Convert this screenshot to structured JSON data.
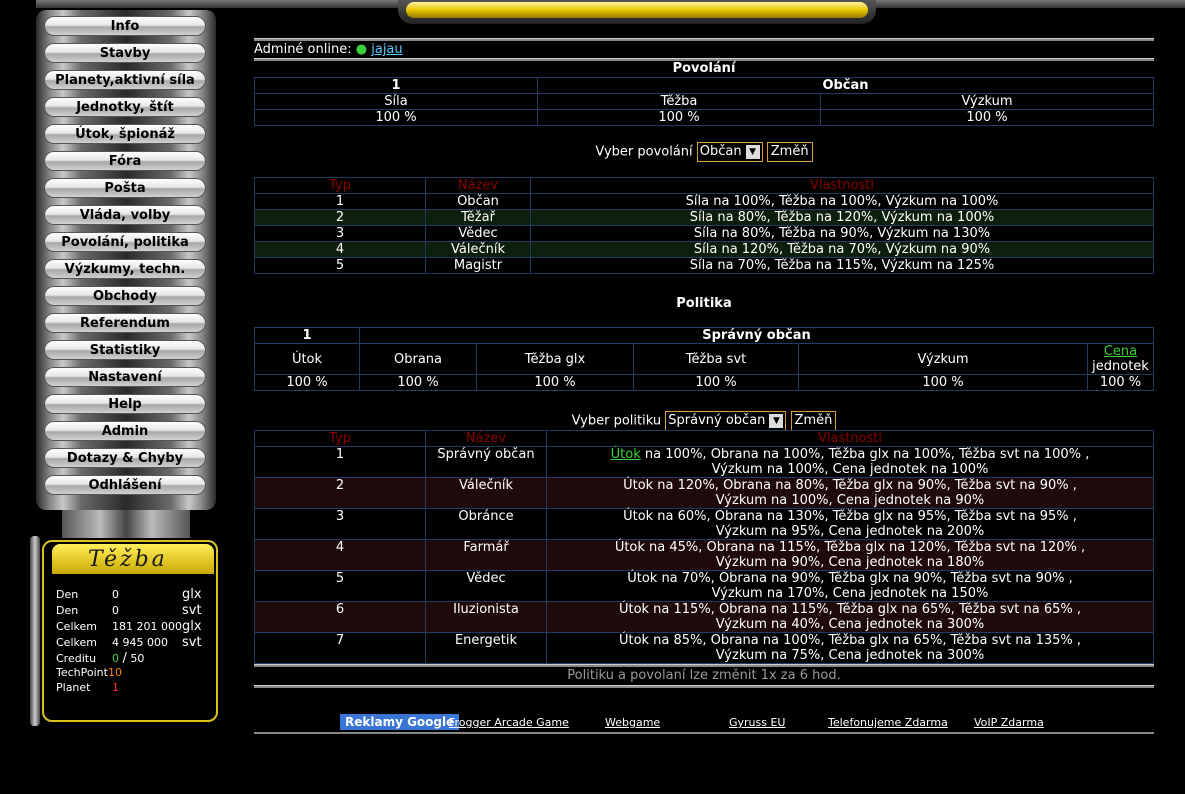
{
  "sidebar": {
    "items": [
      {
        "label": "Info"
      },
      {
        "label": "Stavby"
      },
      {
        "label": "Planety,aktivní síla"
      },
      {
        "label": "Jednotky, štít"
      },
      {
        "label": "Útok, špionáž"
      },
      {
        "label": "Fóra"
      },
      {
        "label": "Pošta"
      },
      {
        "label": "Vláda, volby"
      },
      {
        "label": "Povolání, politika"
      },
      {
        "label": "Výzkumy, techn."
      },
      {
        "label": "Obchody"
      },
      {
        "label": "Referendum"
      },
      {
        "label": "Statistiky"
      },
      {
        "label": "Nastavení"
      },
      {
        "label": "Help"
      },
      {
        "label": "Admin"
      },
      {
        "label": "Dotazy & Chyby"
      },
      {
        "label": "Odhlášení"
      }
    ]
  },
  "resources": {
    "title": "Těžba",
    "rows": [
      {
        "label": "Den",
        "value": "0",
        "unit": "glx"
      },
      {
        "label": "Den",
        "value": "0",
        "unit": "svt"
      },
      {
        "label": "Celkem",
        "value": "181 201 000",
        "unit": "glx"
      },
      {
        "label": "Celkem",
        "value": "4 945 000",
        "unit": "svt"
      }
    ],
    "credit_label": "Creditu",
    "credit_value": "0",
    "credit_sep": "/",
    "credit_max": "50",
    "techpoint_label": "TechPoint",
    "techpoint_value": "10",
    "planet_label": "Planet",
    "planet_value": "1"
  },
  "online": {
    "label": "Adminé online:",
    "user": "jajau"
  },
  "povolani": {
    "title": "Povolání",
    "current_id": "1",
    "current_name": "Občan",
    "stats_headers": [
      "Síla",
      "Těžba",
      "Výzkum"
    ],
    "stats_values": [
      "100 %",
      "100 %",
      "100 %"
    ],
    "select_label": "Vyber povolání",
    "select_value": "Občan",
    "button": "Změň",
    "list_headers": [
      "Typ",
      "Název",
      "Vlastnosti"
    ],
    "list": [
      {
        "id": "1",
        "name": "Občan",
        "desc": "Síla na 100%, Těžba na 100%, Výzkum na 100%"
      },
      {
        "id": "2",
        "name": "Těžař",
        "desc": "Síla na 80%, Těžba na 120%, Výzkum na 100%"
      },
      {
        "id": "3",
        "name": "Vědec",
        "desc": "Síla na 80%, Těžba na 90%, Výzkum na 130%"
      },
      {
        "id": "4",
        "name": "Válečník",
        "desc": "Síla na 120%, Těžba na 70%, Výzkum na 90%"
      },
      {
        "id": "5",
        "name": "Magistr",
        "desc": "Síla na 70%, Těžba na 115%, Výzkum na 125%"
      }
    ]
  },
  "politika": {
    "title": "Politika",
    "current_id": "1",
    "current_name": "Správný občan",
    "stats_headers": [
      "Útok",
      "Obrana",
      "Těžba glx",
      "Těžba svt",
      "Výzkum"
    ],
    "cena_link": "Cena",
    "cena_suffix": "jednotek",
    "stats_values": [
      "100 %",
      "100 %",
      "100 %",
      "100 %",
      "100 %",
      "100 %"
    ],
    "select_label": "Vyber politiku",
    "select_value": "Správný občan",
    "button": "Změň",
    "list_headers": [
      "Typ",
      "Název",
      "Vlastnosti"
    ],
    "first_link": "Útok",
    "first_line1_rest": "na 100%, Obrana na 100%, Těžba glx na 100%, Těžba svt na 100% ,",
    "first_line2": "Výzkum na 100%, Cena jednotek na 100%",
    "list": [
      {
        "id": "2",
        "name": "Válečník",
        "line1": "Útok na 120%, Obrana na 80%, Těžba glx na 90%, Těžba svt na 90% ,",
        "line2": "Výzkum na 100%, Cena jednotek na 90%"
      },
      {
        "id": "3",
        "name": "Obránce",
        "line1": "Útok na 60%, Obrana na 130%, Těžba glx na 95%, Těžba svt na 95% ,",
        "line2": "Výzkum na 95%, Cena jednotek na 200%"
      },
      {
        "id": "4",
        "name": "Farmář",
        "line1": "Útok na 45%, Obrana na 115%, Těžba glx na 120%, Těžba svt na 120% ,",
        "line2": "Výzkum na 90%, Cena jednotek na 180%"
      },
      {
        "id": "5",
        "name": "Vědec",
        "line1": "Útok na 70%, Obrana na 90%, Těžba glx na 90%, Těžba svt na 90% ,",
        "line2": "Výzkum na 170%, Cena jednotek na 150%"
      },
      {
        "id": "6",
        "name": "Iluzionista",
        "line1": "Útok na 115%, Obrana na 115%, Těžba glx na 65%, Těžba svt na 65% ,",
        "line2": "Výzkum na 40%, Cena jednotek na 300%"
      },
      {
        "id": "7",
        "name": "Energetik",
        "line1": "Útok na 85%, Obrana na 100%, Těžba glx na 65%, Těžba svt na 135% ,",
        "line2": "Výzkum na 75%, Cena jednotek na 300%"
      }
    ],
    "first_id": "1",
    "first_name": "Správný občan",
    "note": "Politiku a povolaní lze změnit 1x za 6 hod."
  },
  "ads": {
    "google": "Reklamy Google",
    "links": [
      "Frogger Arcade Game",
      "Webgame",
      "Gyruss EU",
      "Telefonujeme Zdarma",
      "VoIP Zdarma"
    ]
  }
}
